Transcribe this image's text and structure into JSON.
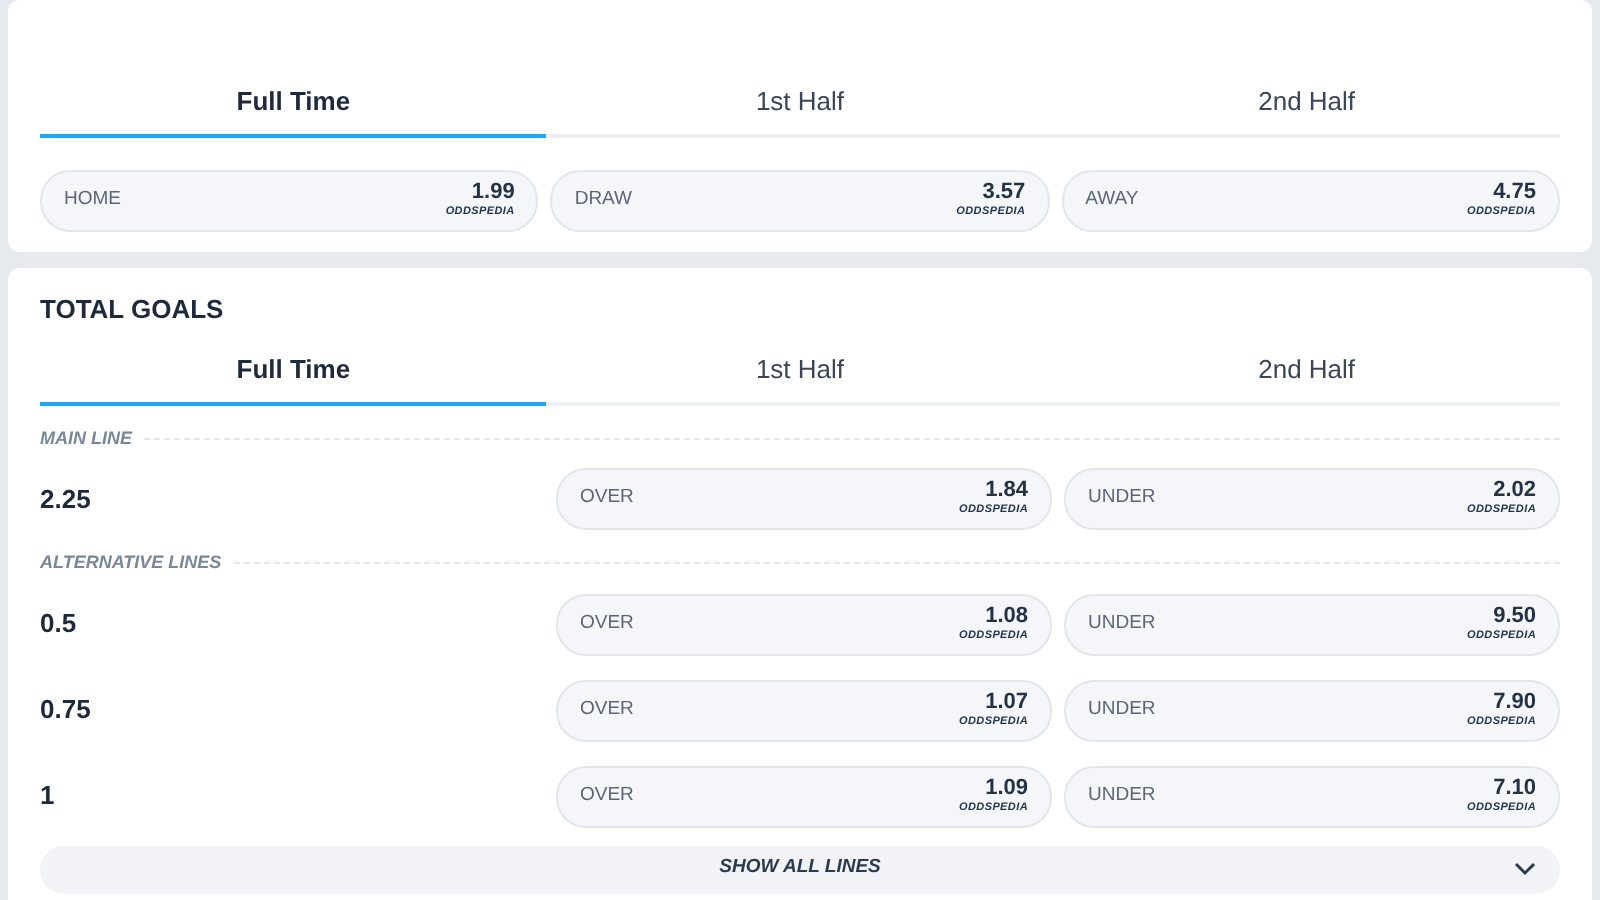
{
  "match_result": {
    "tabs": [
      {
        "label": "Full Time",
        "selected": true
      },
      {
        "label": "1st Half",
        "selected": false
      },
      {
        "label": "2nd Half",
        "selected": false
      }
    ],
    "odds": [
      {
        "label": "HOME",
        "value": "1.99",
        "bookmaker": "ODDSPEDIA"
      },
      {
        "label": "DRAW",
        "value": "3.57",
        "bookmaker": "ODDSPEDIA"
      },
      {
        "label": "AWAY",
        "value": "4.75",
        "bookmaker": "ODDSPEDIA"
      }
    ]
  },
  "total_goals": {
    "title": "TOTAL GOALS",
    "tabs": [
      {
        "label": "Full Time",
        "selected": true
      },
      {
        "label": "1st Half",
        "selected": false
      },
      {
        "label": "2nd Half",
        "selected": false
      }
    ],
    "sections": [
      {
        "heading": "MAIN LINE",
        "lines": [
          {
            "line": "2.25",
            "over": {
              "label": "OVER",
              "value": "1.84",
              "bookmaker": "ODDSPEDIA"
            },
            "under": {
              "label": "UNDER",
              "value": "2.02",
              "bookmaker": "ODDSPEDIA"
            }
          }
        ]
      },
      {
        "heading": "ALTERNATIVE LINES",
        "lines": [
          {
            "line": "0.5",
            "over": {
              "label": "OVER",
              "value": "1.08",
              "bookmaker": "ODDSPEDIA"
            },
            "under": {
              "label": "UNDER",
              "value": "9.50",
              "bookmaker": "ODDSPEDIA"
            }
          },
          {
            "line": "0.75",
            "over": {
              "label": "OVER",
              "value": "1.07",
              "bookmaker": "ODDSPEDIA"
            },
            "under": {
              "label": "UNDER",
              "value": "7.90",
              "bookmaker": "ODDSPEDIA"
            }
          },
          {
            "line": "1",
            "over": {
              "label": "OVER",
              "value": "1.09",
              "bookmaker": "ODDSPEDIA"
            },
            "under": {
              "label": "UNDER",
              "value": "7.10",
              "bookmaker": "ODDSPEDIA"
            }
          }
        ]
      }
    ],
    "show_all": {
      "label": "SHOW ALL LINES",
      "expanded": false
    }
  }
}
